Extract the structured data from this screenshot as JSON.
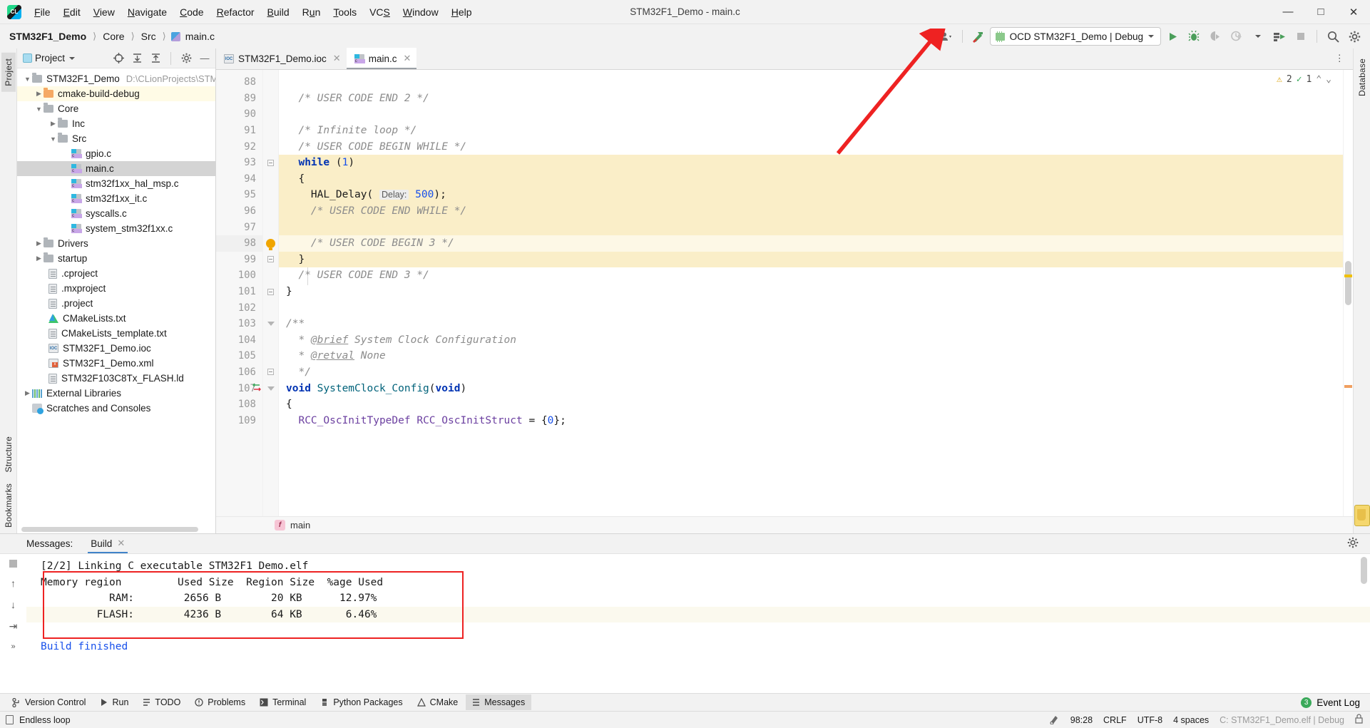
{
  "window": {
    "title": "STM32F1_Demo - main.c"
  },
  "menu": {
    "items": [
      "File",
      "Edit",
      "View",
      "Navigate",
      "Code",
      "Refactor",
      "Build",
      "Run",
      "Tools",
      "VCS",
      "Window",
      "Help"
    ],
    "window_controls": [
      "minimize-icon",
      "maximize-icon",
      "close-icon"
    ]
  },
  "breadcrumb": {
    "project": "STM32F1_Demo",
    "parts": [
      "Core",
      "Src"
    ],
    "file": "main.c"
  },
  "toolbar": {
    "user_icon": "user-icon",
    "hammer_icon": "build-hammer-icon",
    "run_config": "OCD STM32F1_Demo | Debug",
    "run_icon": "run-icon",
    "debug_icon": "debug-icon",
    "coverage_icon": "run-with-coverage-icon",
    "profile_icon": "profile-icon",
    "attach_icon": "attach-to-process-icon",
    "stop_icon": "stop-icon",
    "search_icon": "search-icon",
    "settings_icon": "settings-gear-icon"
  },
  "project_panel": {
    "title": "Project",
    "header_icons": [
      "target-icon",
      "expand-all-icon",
      "collapse-all-icon",
      "settings-gear-icon",
      "hide-icon"
    ],
    "tree": [
      {
        "label": "STM32F1_Demo",
        "path": "D:\\CLionProjects\\STM",
        "icon": "folder-icon",
        "depth": 0,
        "arrow": "expanded",
        "state": "normal"
      },
      {
        "label": "cmake-build-debug",
        "path": "",
        "icon": "folder-orange-icon",
        "depth": 1,
        "arrow": "collapsed",
        "state": "yellow"
      },
      {
        "label": "Core",
        "path": "",
        "icon": "folder-icon",
        "depth": 1,
        "arrow": "expanded",
        "state": "normal"
      },
      {
        "label": "Inc",
        "path": "",
        "icon": "folder-icon",
        "depth": 2,
        "arrow": "collapsed",
        "state": "normal"
      },
      {
        "label": "Src",
        "path": "",
        "icon": "folder-icon",
        "depth": 2,
        "arrow": "expanded",
        "state": "normal"
      },
      {
        "label": "gpio.c",
        "path": "",
        "icon": "c-file-icon",
        "depth": 3,
        "arrow": "none",
        "state": "normal"
      },
      {
        "label": "main.c",
        "path": "",
        "icon": "c-file-icon",
        "depth": 3,
        "arrow": "none",
        "state": "selected"
      },
      {
        "label": "stm32f1xx_hal_msp.c",
        "path": "",
        "icon": "c-file-icon",
        "depth": 3,
        "arrow": "none",
        "state": "normal"
      },
      {
        "label": "stm32f1xx_it.c",
        "path": "",
        "icon": "c-file-icon",
        "depth": 3,
        "arrow": "none",
        "state": "normal"
      },
      {
        "label": "syscalls.c",
        "path": "",
        "icon": "c-file-icon",
        "depth": 3,
        "arrow": "none",
        "state": "normal"
      },
      {
        "label": "system_stm32f1xx.c",
        "path": "",
        "icon": "c-file-icon",
        "depth": 3,
        "arrow": "none",
        "state": "normal"
      },
      {
        "label": "Drivers",
        "path": "",
        "icon": "folder-icon",
        "depth": 1,
        "arrow": "collapsed",
        "state": "normal"
      },
      {
        "label": "startup",
        "path": "",
        "icon": "folder-icon",
        "depth": 1,
        "arrow": "collapsed",
        "state": "normal"
      },
      {
        "label": ".cproject",
        "path": "",
        "icon": "document-icon",
        "depth": 1,
        "arrow": "none",
        "state": "normal"
      },
      {
        "label": ".mxproject",
        "path": "",
        "icon": "document-icon",
        "depth": 1,
        "arrow": "none",
        "state": "normal"
      },
      {
        "label": ".project",
        "path": "",
        "icon": "document-icon",
        "depth": 1,
        "arrow": "none",
        "state": "normal"
      },
      {
        "label": "CMakeLists.txt",
        "path": "",
        "icon": "cmake-icon",
        "depth": 1,
        "arrow": "none",
        "state": "normal"
      },
      {
        "label": "CMakeLists_template.txt",
        "path": "",
        "icon": "document-icon",
        "depth": 1,
        "arrow": "none",
        "state": "normal"
      },
      {
        "label": "STM32F1_Demo.ioc",
        "path": "",
        "icon": "ioc-file-icon",
        "depth": 1,
        "arrow": "none",
        "state": "normal"
      },
      {
        "label": "STM32F1_Demo.xml",
        "path": "",
        "icon": "xml-file-icon",
        "depth": 1,
        "arrow": "none",
        "state": "normal"
      },
      {
        "label": "STM32F103C8Tx_FLASH.ld",
        "path": "",
        "icon": "document-icon",
        "depth": 1,
        "arrow": "none",
        "state": "normal"
      },
      {
        "label": "External Libraries",
        "path": "",
        "icon": "libraries-icon",
        "depth": 0,
        "arrow": "collapsed",
        "state": "normal"
      },
      {
        "label": "Scratches and Consoles",
        "path": "",
        "icon": "scratches-icon",
        "depth": 0,
        "arrow": "none",
        "state": "normal"
      }
    ]
  },
  "left_strip": {
    "tabs": [
      "Project",
      "Structure",
      "Bookmarks"
    ]
  },
  "right_strip": {
    "tabs": [
      "Database"
    ]
  },
  "editor": {
    "tabs": [
      {
        "label": "STM32F1_Demo.ioc",
        "icon": "ioc-file-icon",
        "active": false
      },
      {
        "label": "main.c",
        "icon": "c-file-icon",
        "active": true
      }
    ],
    "inspection": {
      "warnings": "2",
      "checks": "1"
    },
    "first_line": 88,
    "lines": [
      {
        "n": 88,
        "text": "",
        "hl": "none",
        "fold": "none"
      },
      {
        "n": 89,
        "text": "  /* USER CODE END 2 */",
        "hl": "none",
        "fold": "none"
      },
      {
        "n": 90,
        "text": "",
        "hl": "none",
        "fold": "none"
      },
      {
        "n": 91,
        "text": "  /* Infinite loop */",
        "hl": "none",
        "fold": "none"
      },
      {
        "n": 92,
        "text": "  /* USER CODE BEGIN WHILE */",
        "hl": "none",
        "fold": "none"
      },
      {
        "n": 93,
        "text": "  while (1)",
        "hl": "block",
        "fold": "open"
      },
      {
        "n": 94,
        "text": "  {",
        "hl": "block",
        "fold": "none"
      },
      {
        "n": 95,
        "text": "    HAL_Delay( Delay: 500);",
        "hl": "block",
        "fold": "none"
      },
      {
        "n": 96,
        "text": "    /* USER CODE END WHILE */",
        "hl": "block",
        "fold": "none"
      },
      {
        "n": 97,
        "text": "",
        "hl": "block",
        "fold": "none"
      },
      {
        "n": 98,
        "text": "    /* USER CODE BEGIN 3 */",
        "hl": "current",
        "fold": "bulb"
      },
      {
        "n": 99,
        "text": "  }",
        "hl": "block",
        "fold": "open"
      },
      {
        "n": 100,
        "text": "  /* USER CODE END 3 */",
        "hl": "none",
        "fold": "none"
      },
      {
        "n": 101,
        "text": "}",
        "hl": "none",
        "fold": "open"
      },
      {
        "n": 102,
        "text": "",
        "hl": "none",
        "fold": "none"
      },
      {
        "n": 103,
        "text": "/**",
        "hl": "none",
        "fold": "tri"
      },
      {
        "n": 104,
        "text": "  * @brief System Clock Configuration",
        "hl": "none",
        "fold": "none"
      },
      {
        "n": 105,
        "text": "  * @retval None",
        "hl": "none",
        "fold": "none"
      },
      {
        "n": 106,
        "text": "  */",
        "hl": "none",
        "fold": "open"
      },
      {
        "n": 107,
        "text": "void SystemClock_Config(void)",
        "hl": "none",
        "fold": "tri"
      },
      {
        "n": 108,
        "text": "{",
        "hl": "none",
        "fold": "none"
      },
      {
        "n": 109,
        "text": "  RCC_OscInitTypeDef RCC_OscInitStruct = {0};",
        "hl": "none",
        "fold": "none"
      }
    ],
    "bottom_breadcrumb": "main",
    "caret": "98:28"
  },
  "messages_panel": {
    "title": "Messages:",
    "tab": "Build",
    "side_icons": [
      "stop-icon",
      "scroll-up-icon",
      "scroll-down-icon",
      "wrap-icon",
      "expand-icon"
    ],
    "gear_icon": "settings-gear-icon",
    "console": [
      {
        "text": "[2/2] Linking C executable STM32F1_Demo.elf",
        "style": "normal",
        "stripe": false
      },
      {
        "text": "Memory region         Used Size  Region Size  %age Used",
        "style": "normal",
        "stripe": false
      },
      {
        "text": "           RAM:        2656 B        20 KB      12.97%",
        "style": "normal",
        "stripe": false
      },
      {
        "text": "         FLASH:        4236 B        64 KB       6.46%",
        "style": "normal",
        "stripe": true
      },
      {
        "text": "",
        "style": "normal",
        "stripe": false
      },
      {
        "text": "Build finished",
        "style": "blue",
        "stripe": false
      }
    ],
    "memory_table": {
      "headers": [
        "Memory region",
        "Used Size",
        "Region Size",
        "%age Used"
      ],
      "rows": [
        [
          "RAM:",
          "2656 B",
          "20 KB",
          "12.97%"
        ],
        [
          "FLASH:",
          "4236 B",
          "64 KB",
          "6.46%"
        ]
      ]
    },
    "highlight_color": "#ee2222"
  },
  "tool_window_bar": {
    "items": [
      {
        "label": "Version Control",
        "icon": "branch-icon",
        "sel": false
      },
      {
        "label": "Run",
        "icon": "run-icon",
        "sel": false
      },
      {
        "label": "TODO",
        "icon": "todo-icon",
        "sel": false
      },
      {
        "label": "Problems",
        "icon": "problems-icon",
        "sel": false
      },
      {
        "label": "Terminal",
        "icon": "terminal-icon",
        "sel": false
      },
      {
        "label": "Python Packages",
        "icon": "python-icon",
        "sel": false
      },
      {
        "label": "CMake",
        "icon": "cmake-icon",
        "sel": false
      },
      {
        "label": "Messages",
        "icon": "messages-icon",
        "sel": true
      }
    ],
    "event_log": {
      "label": "Event Log",
      "count": "3"
    }
  },
  "status_bar": {
    "left_icon": "console-icon",
    "message": "Endless loop",
    "caret": "98:28",
    "line_sep": "CRLF",
    "encoding": "UTF-8",
    "indent": "4 spaces",
    "config": "C: STM32F1_Demo.elf | Debug",
    "right_icon": "lock-icon"
  },
  "colors": {
    "accent": "#4083c9",
    "highlight_line": "#faeec8",
    "annotation": "#ee2222",
    "green": "#3aa95a"
  }
}
